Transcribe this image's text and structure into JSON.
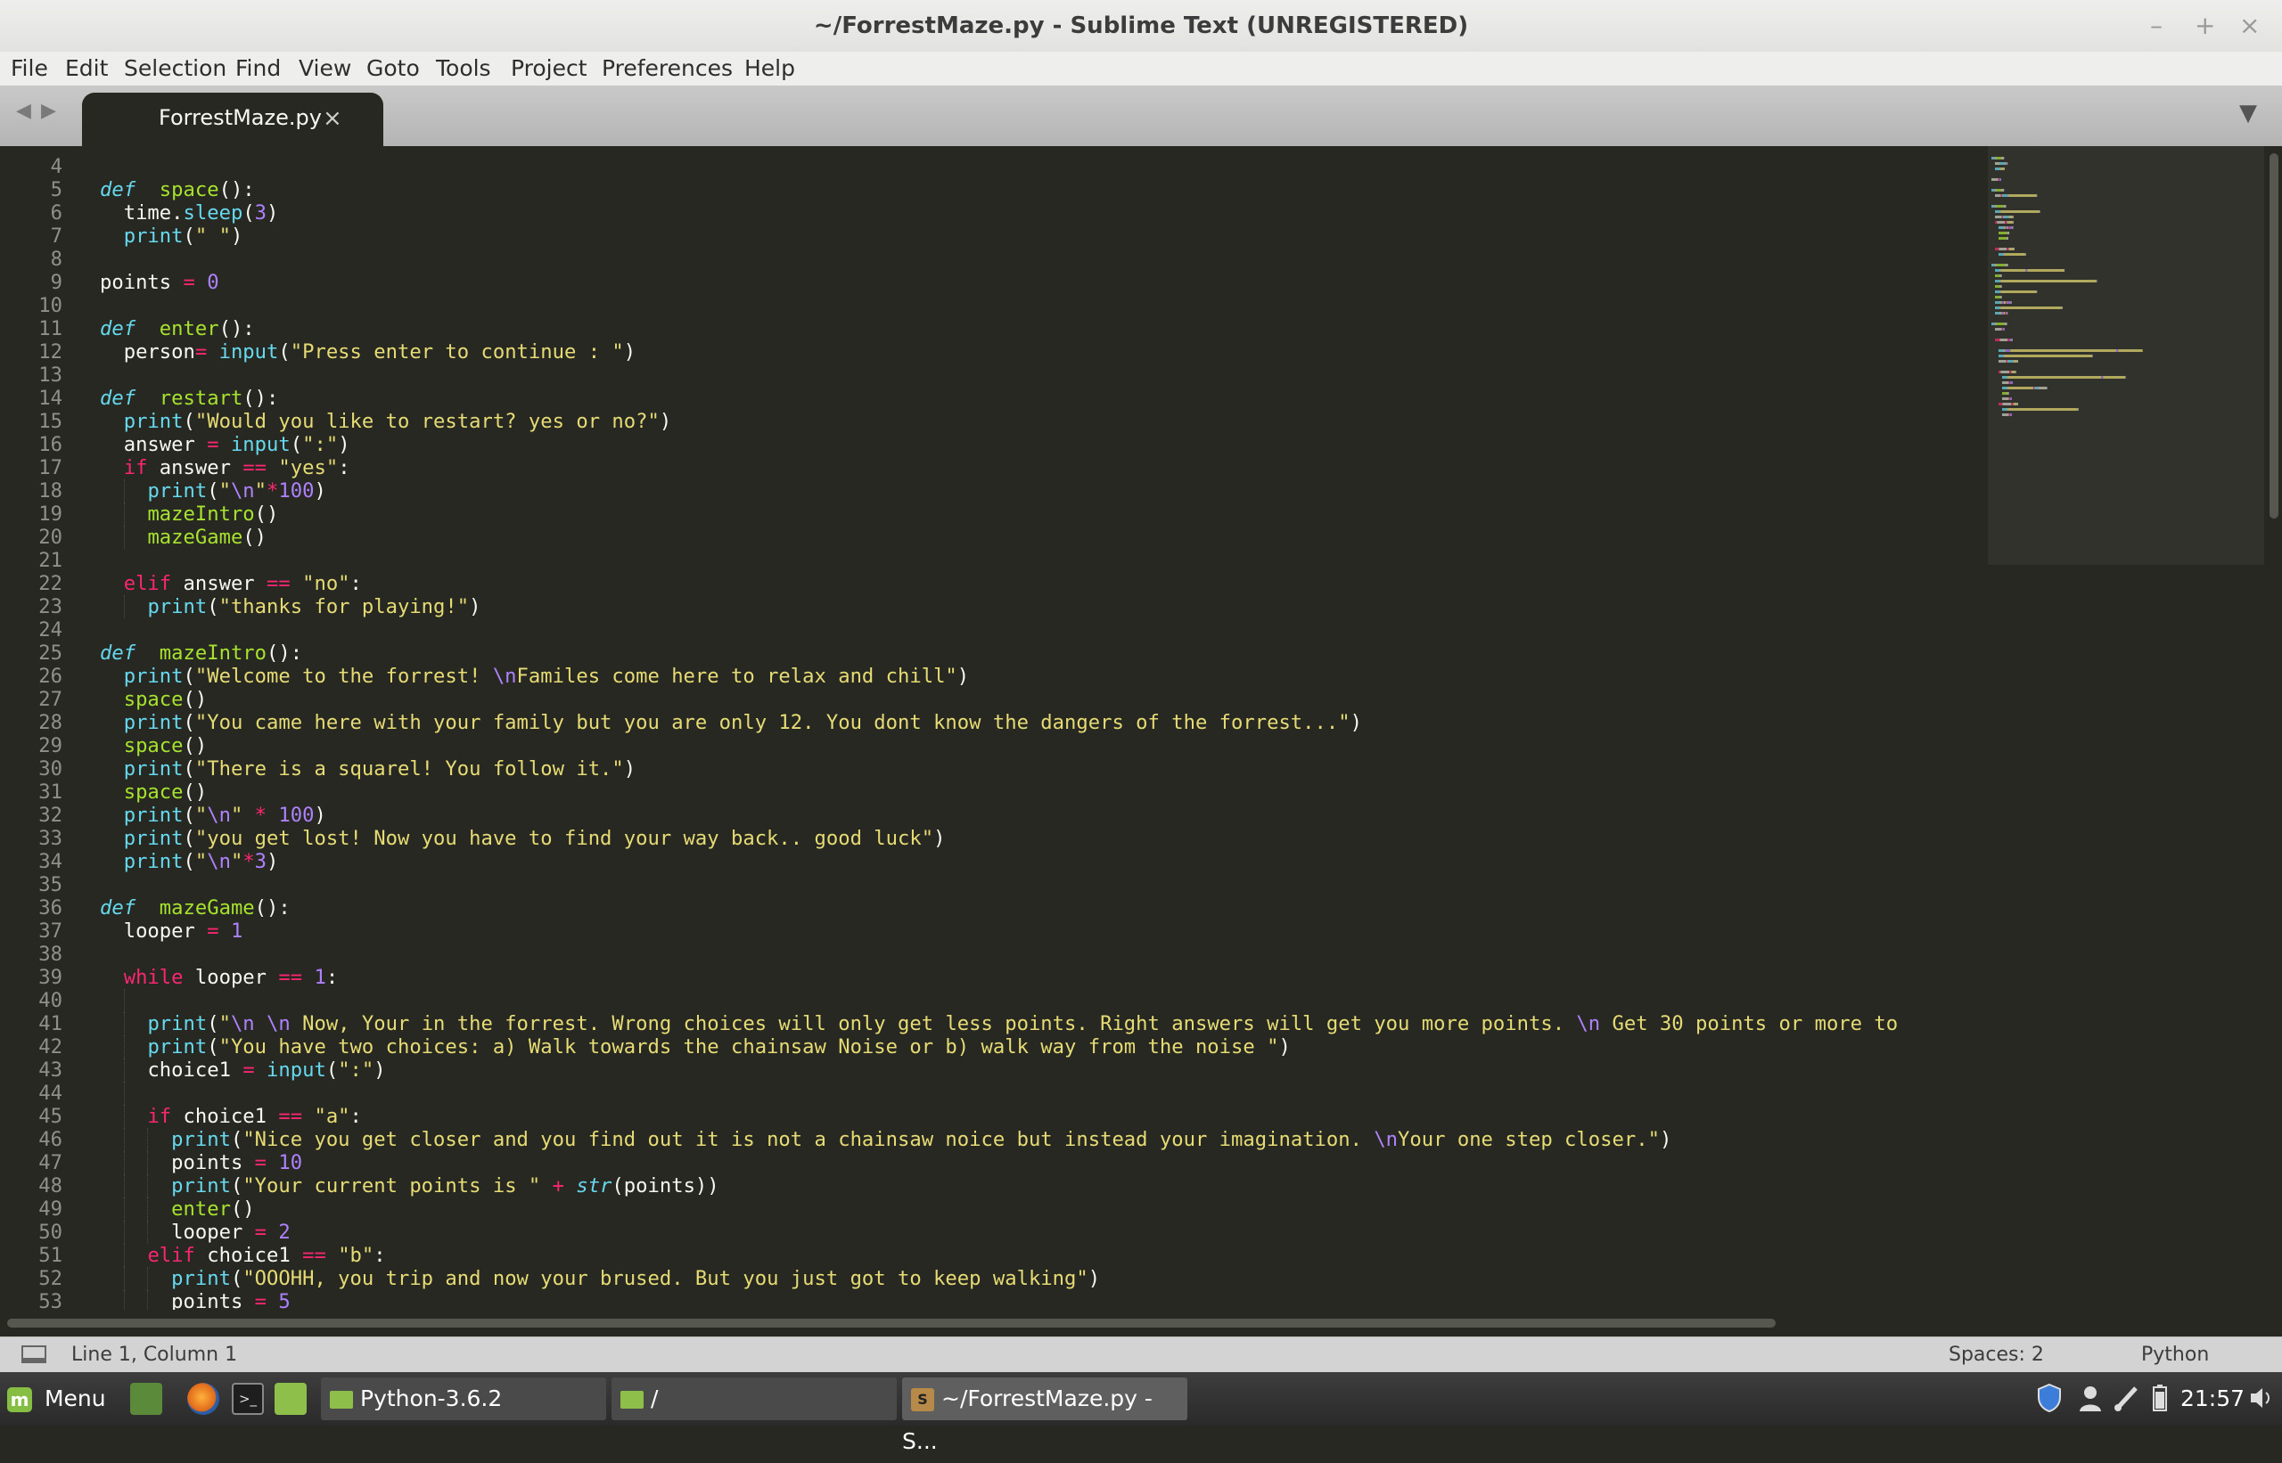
{
  "window": {
    "title": "~/ForrestMaze.py - Sublime Text (UNREGISTERED)",
    "controls": {
      "minimize": "–",
      "maximize": "+",
      "close": "×"
    }
  },
  "menu": [
    "File",
    "Edit",
    "Selection",
    "Find",
    "View",
    "Goto",
    "Tools",
    "Project",
    "Preferences",
    "Help"
  ],
  "tabs": {
    "nav_prev": "◀",
    "nav_next": "▶",
    "active_label": "ForrestMaze.py",
    "close_glyph": "×",
    "dropdown_glyph": "▼"
  },
  "status": {
    "position": "Line 1, Column 1",
    "indent": "Spaces: 2",
    "syntax": "Python"
  },
  "taskbar": {
    "menu_label": "Menu",
    "mint_glyph": "m",
    "terminal_glyph": ">_",
    "tasks": [
      "Python-3.6.2",
      "/",
      "~/ForrestMaze.py - S..."
    ],
    "clock": "21:57"
  },
  "code": [
    {
      "n": "4",
      "i": 0,
      "t": []
    },
    {
      "n": "5",
      "i": 0,
      "t": [
        [
          "df",
          "def"
        ],
        [
          "",
          "  "
        ],
        [
          "fn",
          "space"
        ],
        [
          "",
          "():"
        ]
      ]
    },
    {
      "n": "6",
      "i": 1,
      "t": [
        [
          "",
          "time."
        ],
        [
          "bi",
          "sleep"
        ],
        [
          "",
          "("
        ],
        [
          "nu",
          "3"
        ],
        [
          "",
          ")"
        ]
      ]
    },
    {
      "n": "7",
      "i": 1,
      "t": [
        [
          "bi",
          "print"
        ],
        [
          "",
          "("
        ],
        [
          "st",
          "\" \""
        ],
        [
          "",
          ")"
        ]
      ]
    },
    {
      "n": "8",
      "i": 0,
      "t": []
    },
    {
      "n": "9",
      "i": 0,
      "t": [
        [
          "",
          "points "
        ],
        [
          "op",
          "="
        ],
        [
          "nu",
          " 0"
        ]
      ]
    },
    {
      "n": "10",
      "i": 0,
      "t": []
    },
    {
      "n": "11",
      "i": 0,
      "t": [
        [
          "df",
          "def"
        ],
        [
          "",
          "  "
        ],
        [
          "fn",
          "enter"
        ],
        [
          "",
          "():"
        ]
      ]
    },
    {
      "n": "12",
      "i": 1,
      "t": [
        [
          "",
          "person"
        ],
        [
          "op",
          "="
        ],
        [
          "",
          " "
        ],
        [
          "bi",
          "input"
        ],
        [
          "",
          "("
        ],
        [
          "st",
          "\"Press enter to continue : \""
        ],
        [
          "",
          ")"
        ]
      ]
    },
    {
      "n": "13",
      "i": 0,
      "t": []
    },
    {
      "n": "14",
      "i": 0,
      "t": [
        [
          "df",
          "def"
        ],
        [
          "",
          "  "
        ],
        [
          "fn",
          "restart"
        ],
        [
          "",
          "():"
        ]
      ]
    },
    {
      "n": "15",
      "i": 1,
      "t": [
        [
          "bi",
          "print"
        ],
        [
          "",
          "("
        ],
        [
          "st",
          "\"Would you like to restart? yes or no?\""
        ],
        [
          "",
          ")"
        ]
      ]
    },
    {
      "n": "16",
      "i": 1,
      "t": [
        [
          "",
          "answer "
        ],
        [
          "op",
          "="
        ],
        [
          "",
          " "
        ],
        [
          "bi",
          "input"
        ],
        [
          "",
          "("
        ],
        [
          "st",
          "\":\""
        ],
        [
          "",
          ")"
        ]
      ]
    },
    {
      "n": "17",
      "i": 1,
      "t": [
        [
          "kw",
          "if"
        ],
        [
          "",
          " answer "
        ],
        [
          "op",
          "=="
        ],
        [
          "",
          " "
        ],
        [
          "st",
          "\"yes\""
        ],
        [
          "",
          ":"
        ]
      ]
    },
    {
      "n": "18",
      "i": 2,
      "t": [
        [
          "bi",
          "print"
        ],
        [
          "",
          "("
        ],
        [
          "st",
          "\""
        ],
        [
          "esc",
          "\\n"
        ],
        [
          "st",
          "\""
        ],
        [
          "op",
          "*"
        ],
        [
          "nu",
          "100"
        ],
        [
          "",
          ")"
        ]
      ]
    },
    {
      "n": "19",
      "i": 2,
      "t": [
        [
          "fn",
          "mazeIntro"
        ],
        [
          "",
          "()"
        ]
      ]
    },
    {
      "n": "20",
      "i": 2,
      "t": [
        [
          "fn",
          "mazeGame"
        ],
        [
          "",
          "()"
        ]
      ]
    },
    {
      "n": "21",
      "i": 1,
      "t": []
    },
    {
      "n": "22",
      "i": 1,
      "t": [
        [
          "kw",
          "elif"
        ],
        [
          "",
          " answer "
        ],
        [
          "op",
          "=="
        ],
        [
          "",
          " "
        ],
        [
          "st",
          "\"no\""
        ],
        [
          "",
          ":"
        ]
      ]
    },
    {
      "n": "23",
      "i": 2,
      "t": [
        [
          "bi",
          "print"
        ],
        [
          "",
          "("
        ],
        [
          "st",
          "\"thanks for playing!\""
        ],
        [
          "",
          ")"
        ]
      ]
    },
    {
      "n": "24",
      "i": 0,
      "t": []
    },
    {
      "n": "25",
      "i": 0,
      "t": [
        [
          "df",
          "def"
        ],
        [
          "",
          "  "
        ],
        [
          "fn",
          "mazeIntro"
        ],
        [
          "",
          "():"
        ]
      ]
    },
    {
      "n": "26",
      "i": 1,
      "t": [
        [
          "bi",
          "print"
        ],
        [
          "",
          "("
        ],
        [
          "st",
          "\"Welcome to the forrest! "
        ],
        [
          "esc",
          "\\n"
        ],
        [
          "st",
          "Familes come here to relax and chill\""
        ],
        [
          "",
          ")"
        ]
      ]
    },
    {
      "n": "27",
      "i": 1,
      "t": [
        [
          "fn",
          "space"
        ],
        [
          "",
          "()"
        ]
      ]
    },
    {
      "n": "28",
      "i": 1,
      "t": [
        [
          "bi",
          "print"
        ],
        [
          "",
          "("
        ],
        [
          "st",
          "\"You came here with your family but you are only 12. You dont know the dangers of the forrest...\""
        ],
        [
          "",
          ")"
        ]
      ]
    },
    {
      "n": "29",
      "i": 1,
      "t": [
        [
          "fn",
          "space"
        ],
        [
          "",
          "()"
        ]
      ]
    },
    {
      "n": "30",
      "i": 1,
      "t": [
        [
          "bi",
          "print"
        ],
        [
          "",
          "("
        ],
        [
          "st",
          "\"There is a squarel! You follow it.\""
        ],
        [
          "",
          ")"
        ]
      ]
    },
    {
      "n": "31",
      "i": 1,
      "t": [
        [
          "fn",
          "space"
        ],
        [
          "",
          "()"
        ]
      ]
    },
    {
      "n": "32",
      "i": 1,
      "t": [
        [
          "bi",
          "print"
        ],
        [
          "",
          "("
        ],
        [
          "st",
          "\""
        ],
        [
          "esc",
          "\\n"
        ],
        [
          "st",
          "\""
        ],
        [
          "",
          " "
        ],
        [
          "op",
          "*"
        ],
        [
          "",
          " "
        ],
        [
          "nu",
          "100"
        ],
        [
          "",
          ")"
        ]
      ]
    },
    {
      "n": "33",
      "i": 1,
      "t": [
        [
          "bi",
          "print"
        ],
        [
          "",
          "("
        ],
        [
          "st",
          "\"you get lost! Now you have to find your way back.. good luck\""
        ],
        [
          "",
          ")"
        ]
      ]
    },
    {
      "n": "34",
      "i": 1,
      "t": [
        [
          "bi",
          "print"
        ],
        [
          "",
          "("
        ],
        [
          "st",
          "\""
        ],
        [
          "esc",
          "\\n"
        ],
        [
          "st",
          "\""
        ],
        [
          "op",
          "*"
        ],
        [
          "nu",
          "3"
        ],
        [
          "",
          ")"
        ]
      ]
    },
    {
      "n": "35",
      "i": 0,
      "t": []
    },
    {
      "n": "36",
      "i": 0,
      "t": [
        [
          "df",
          "def"
        ],
        [
          "",
          "  "
        ],
        [
          "fn",
          "mazeGame"
        ],
        [
          "",
          "():"
        ]
      ]
    },
    {
      "n": "37",
      "i": 1,
      "t": [
        [
          "",
          "looper "
        ],
        [
          "op",
          "="
        ],
        [
          "nu",
          " 1"
        ]
      ]
    },
    {
      "n": "38",
      "i": 1,
      "t": []
    },
    {
      "n": "39",
      "i": 1,
      "t": [
        [
          "kw",
          "while"
        ],
        [
          "",
          " looper "
        ],
        [
          "op",
          "=="
        ],
        [
          "nu",
          " 1"
        ],
        [
          "",
          ":"
        ]
      ]
    },
    {
      "n": "40",
      "i": 2,
      "t": []
    },
    {
      "n": "41",
      "i": 2,
      "t": [
        [
          "bi",
          "print"
        ],
        [
          "",
          "("
        ],
        [
          "st",
          "\""
        ],
        [
          "esc",
          "\\n \\n"
        ],
        [
          "st",
          " Now, Your in the forrest. Wrong choices will only get less points. Right answers will get you more points. "
        ],
        [
          "esc",
          "\\n"
        ],
        [
          "st",
          " Get 30 points or more to"
        ]
      ]
    },
    {
      "n": "42",
      "i": 2,
      "t": [
        [
          "bi",
          "print"
        ],
        [
          "",
          "("
        ],
        [
          "st",
          "\"You have two choices: a) Walk towards the chainsaw Noise or b) walk way from the noise \""
        ],
        [
          "",
          ")"
        ]
      ]
    },
    {
      "n": "43",
      "i": 2,
      "t": [
        [
          "",
          "choice1 "
        ],
        [
          "op",
          "="
        ],
        [
          "",
          " "
        ],
        [
          "bi",
          "input"
        ],
        [
          "",
          "("
        ],
        [
          "st",
          "\":\""
        ],
        [
          "",
          ")"
        ]
      ]
    },
    {
      "n": "44",
      "i": 2,
      "t": []
    },
    {
      "n": "45",
      "i": 2,
      "t": [
        [
          "kw",
          "if"
        ],
        [
          "",
          " choice1 "
        ],
        [
          "op",
          "=="
        ],
        [
          "",
          " "
        ],
        [
          "st",
          "\"a\""
        ],
        [
          "",
          ":"
        ]
      ]
    },
    {
      "n": "46",
      "i": 3,
      "t": [
        [
          "bi",
          "print"
        ],
        [
          "",
          "("
        ],
        [
          "st",
          "\"Nice you get closer and you find out it is not a chainsaw noice but instead your imagination. "
        ],
        [
          "esc",
          "\\n"
        ],
        [
          "st",
          "Your one step closer.\""
        ],
        [
          "",
          ")"
        ]
      ]
    },
    {
      "n": "47",
      "i": 3,
      "t": [
        [
          "",
          "points "
        ],
        [
          "op",
          "="
        ],
        [
          "nu",
          " 10"
        ]
      ]
    },
    {
      "n": "48",
      "i": 3,
      "t": [
        [
          "bi",
          "print"
        ],
        [
          "",
          "("
        ],
        [
          "st",
          "\"Your current points is \""
        ],
        [
          "",
          " "
        ],
        [
          "op",
          "+"
        ],
        [
          "",
          " "
        ],
        [
          "df",
          "str"
        ],
        [
          "",
          "(points))"
        ]
      ]
    },
    {
      "n": "49",
      "i": 3,
      "t": [
        [
          "fn",
          "enter"
        ],
        [
          "",
          "()"
        ]
      ]
    },
    {
      "n": "50",
      "i": 3,
      "t": [
        [
          "",
          "looper "
        ],
        [
          "op",
          "="
        ],
        [
          "nu",
          " 2"
        ]
      ]
    },
    {
      "n": "51",
      "i": 2,
      "t": [
        [
          "kw",
          "elif"
        ],
        [
          "",
          " choice1 "
        ],
        [
          "op",
          "=="
        ],
        [
          "",
          " "
        ],
        [
          "st",
          "\"b\""
        ],
        [
          "",
          ":"
        ]
      ]
    },
    {
      "n": "52",
      "i": 3,
      "t": [
        [
          "bi",
          "print"
        ],
        [
          "",
          "("
        ],
        [
          "st",
          "\"OOOHH, you trip and now your brused. But you just got to keep walking\""
        ],
        [
          "",
          ")"
        ]
      ]
    },
    {
      "n": "53",
      "i": 3,
      "t": [
        [
          "",
          "points "
        ],
        [
          "op",
          "="
        ],
        [
          "nu",
          " 5"
        ]
      ]
    }
  ]
}
